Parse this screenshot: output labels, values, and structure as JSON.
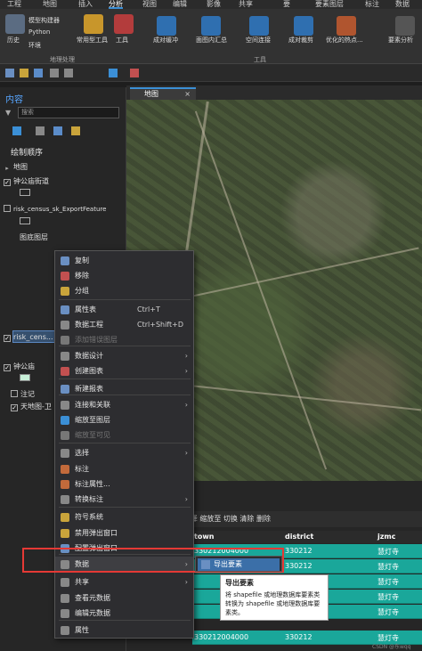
{
  "ribbon": {
    "tabs": [
      "工程",
      "地图",
      "插入",
      "分析",
      "视图",
      "编辑",
      "影像",
      "共享",
      "要",
      "要素图层",
      "标注",
      "数据"
    ],
    "active_tab": "分析",
    "buttons": {
      "history": "历史",
      "model_builder": "模型构建器",
      "python": "Python",
      "environment": "环境",
      "tools_common": "常用型工具",
      "tools": "工具",
      "summarize_nearby": "成对缓冲",
      "summarize_within": "面图内汇总",
      "spatial_join": "空间连接",
      "pairwise_clip": "成对裁剪",
      "optimized_hotspot": "优化的热点...",
      "feature_analysis": "要素分析"
    },
    "groups": [
      "地理处理",
      "工具"
    ]
  },
  "contents": {
    "title": "内容",
    "search_placeholder": "搜索",
    "drawing_order": "绘制顺序",
    "items": [
      {
        "label": "地图",
        "checked": false
      },
      {
        "label": "钟公庙街道",
        "checked": true
      },
      {
        "label": "risk_census_sk_ExportFeature",
        "checked": false
      },
      {
        "label": "图底图层",
        "checked": false
      },
      {
        "label": "risk_cens...",
        "checked": true
      },
      {
        "label": "钟公庙",
        "checked": true
      },
      {
        "label": "注记",
        "checked": false
      },
      {
        "label": "天地图-卫",
        "checked": true
      }
    ]
  },
  "map": {
    "tab_label": "地图"
  },
  "context_menu": {
    "items": [
      {
        "label": "复制",
        "shortcut": "",
        "submenu": false,
        "disabled": false
      },
      {
        "label": "移除",
        "shortcut": "",
        "submenu": false,
        "disabled": false
      },
      {
        "label": "分组",
        "shortcut": "",
        "submenu": false,
        "disabled": false
      },
      {
        "label": "属性表",
        "shortcut": "Ctrl+T",
        "submenu": false,
        "disabled": false
      },
      {
        "label": "数据工程",
        "shortcut": "Ctrl+Shift+D",
        "submenu": false,
        "disabled": false
      },
      {
        "label": "添加错误图层",
        "shortcut": "",
        "submenu": false,
        "disabled": true
      },
      {
        "label": "数据设计",
        "shortcut": "",
        "submenu": true,
        "disabled": false
      },
      {
        "label": "创建图表",
        "shortcut": "",
        "submenu": true,
        "disabled": false
      },
      {
        "label": "新建报表",
        "shortcut": "",
        "submenu": false,
        "disabled": false
      },
      {
        "label": "连接和关联",
        "shortcut": "",
        "submenu": true,
        "disabled": false
      },
      {
        "label": "缩放至图层",
        "shortcut": "",
        "submenu": false,
        "disabled": false
      },
      {
        "label": "缩放至可见",
        "shortcut": "",
        "submenu": false,
        "disabled": true
      },
      {
        "label": "选择",
        "shortcut": "",
        "submenu": true,
        "disabled": false
      },
      {
        "label": "标注",
        "shortcut": "",
        "submenu": false,
        "disabled": false
      },
      {
        "label": "标注属性...",
        "shortcut": "",
        "submenu": false,
        "disabled": false
      },
      {
        "label": "转换标注",
        "shortcut": "",
        "submenu": true,
        "disabled": false
      },
      {
        "label": "符号系统",
        "shortcut": "",
        "submenu": false,
        "disabled": false
      },
      {
        "label": "禁用弹出窗口",
        "shortcut": "",
        "submenu": false,
        "disabled": false
      },
      {
        "label": "配置弹出窗口",
        "shortcut": "",
        "submenu": false,
        "disabled": false
      },
      {
        "label": "数据",
        "shortcut": "",
        "submenu": true,
        "disabled": false
      },
      {
        "label": "共享",
        "shortcut": "",
        "submenu": true,
        "disabled": false
      },
      {
        "label": "查看元数据",
        "shortcut": "",
        "submenu": false,
        "disabled": false
      },
      {
        "label": "编辑元数据",
        "shortcut": "",
        "submenu": false,
        "disabled": false
      },
      {
        "label": "属性",
        "shortcut": "",
        "submenu": false,
        "disabled": false
      }
    ]
  },
  "submenu": {
    "export_features": "导出要素"
  },
  "tooltip": {
    "title": "导出要素",
    "body": "将 shapefile 或地理数据库要素类转换为 shapefile 或地理数据库要素类。"
  },
  "attribute_table": {
    "toolbar": "计算  选择: 按属性选择  缩放至  切换  清除  删除",
    "columns": [
      "town",
      "district",
      "jzmc"
    ],
    "rows": [
      [
        "330212004000",
        "330212",
        "慧灯寺"
      ],
      [
        "",
        "330212",
        "慧灯寺"
      ],
      [
        "",
        "330212",
        "慧灯寺"
      ],
      [
        "",
        "330212",
        "慧灯寺"
      ],
      [
        "",
        "330212",
        "慧灯寺"
      ],
      [
        "330212004000",
        "330212",
        "慧灯寺"
      ]
    ]
  },
  "watermark": "CSDN @东wqq"
}
